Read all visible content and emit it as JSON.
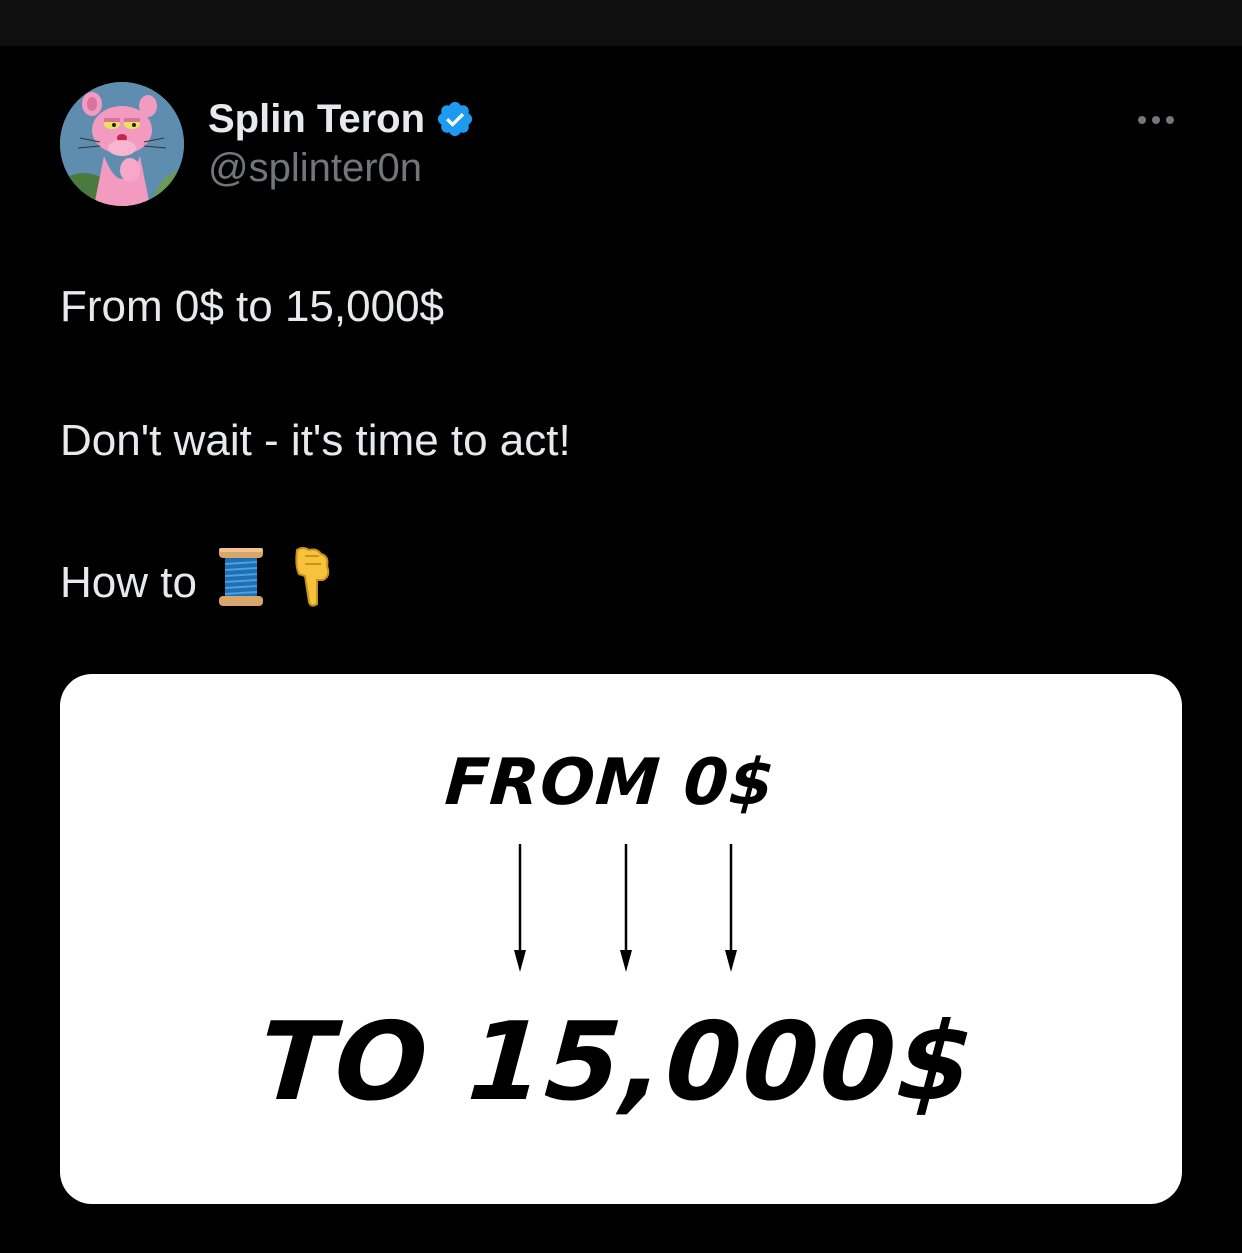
{
  "tweet": {
    "author": {
      "display_name": "Splin Teron",
      "handle": "@splinter0n",
      "verified": true,
      "verified_badge_icon": "verified-checkmark-icon",
      "avatar_description": "pink-panther-avatar"
    },
    "more_icon": "more-horizontal-icon",
    "lines": {
      "line1": "From 0$ to 15,000$",
      "line2": "Don't wait - it's time to act!",
      "line3_text": "How to",
      "line3_emojis": [
        "thread-spool-icon",
        "backhand-index-pointing-down-icon"
      ]
    },
    "media": {
      "top_text": "FROM 0$",
      "bottom_text": "TO 15,000$",
      "arrow_icon": "down-arrow-icon"
    }
  },
  "colors": {
    "background": "#000000",
    "top_bar": "#0f0f0f",
    "primary_text": "#e7e9ea",
    "secondary_text": "#71767b",
    "verified_blue": "#1d9bf0",
    "media_background": "#ffffff"
  }
}
